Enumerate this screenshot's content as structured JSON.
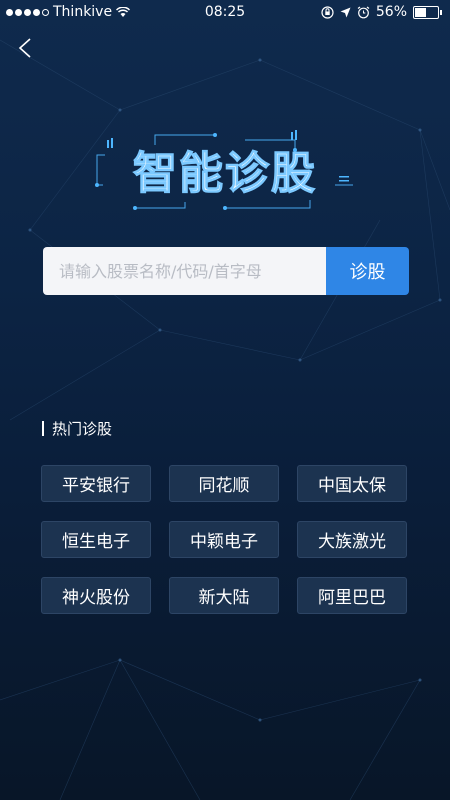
{
  "status_bar": {
    "carrier": "Thinkive",
    "time": "08:25",
    "battery": "56%",
    "battery_level": 0.56
  },
  "nav": {
    "back_icon": "chevron-left-icon"
  },
  "logo": {
    "text": "智能诊股"
  },
  "search": {
    "placeholder": "请输入股票名称/代码/首字母",
    "value": "",
    "button_label": "诊股"
  },
  "hot": {
    "title": "热门诊股",
    "stocks": [
      "平安银行",
      "同花顺",
      "中国太保",
      "恒生电子",
      "中颖电子",
      "大族激光",
      "神火股份",
      "新大陆",
      "阿里巴巴"
    ]
  },
  "colors": {
    "background": "#0c2444",
    "accent": "#2f86e6"
  }
}
